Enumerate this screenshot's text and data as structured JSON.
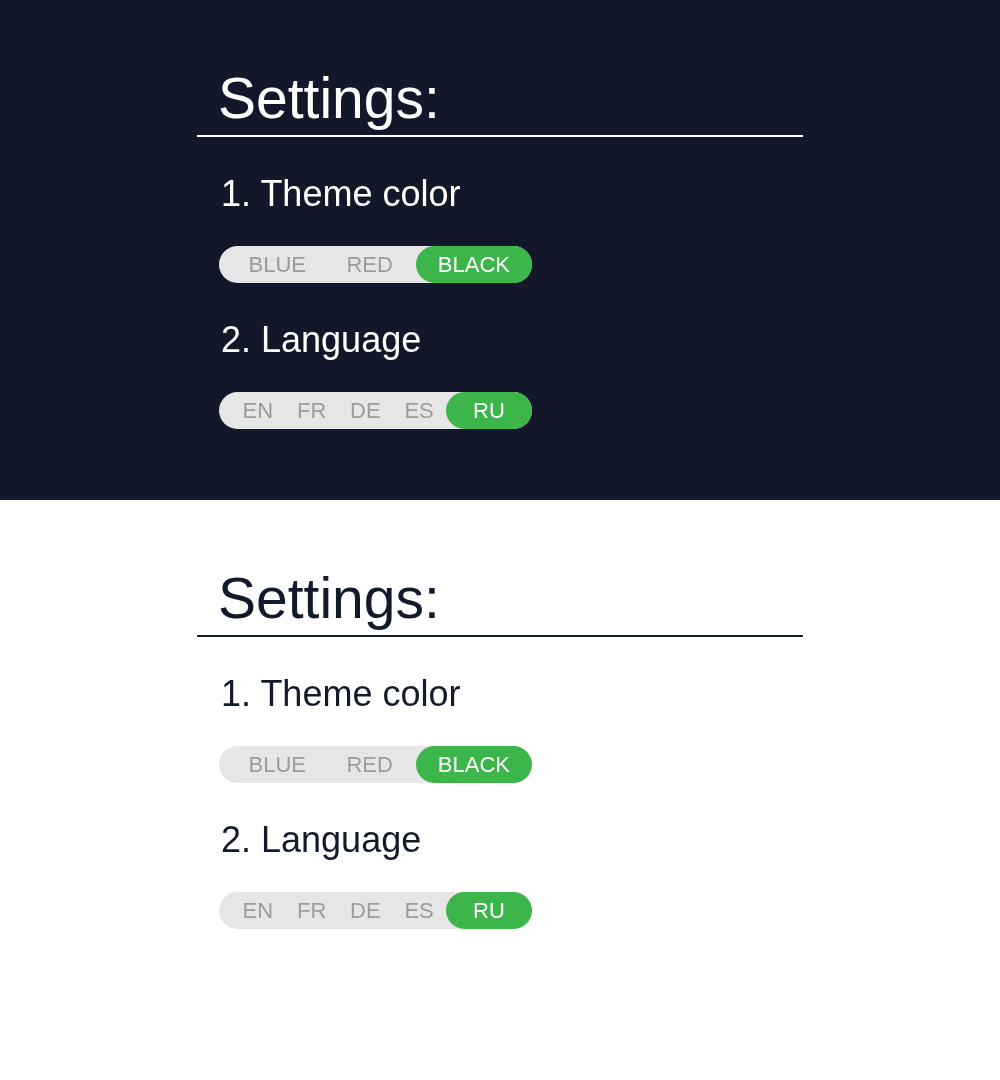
{
  "panels": [
    {
      "kind": "dark",
      "title": "Settings:",
      "sections": [
        {
          "label": "1. Theme color",
          "options": [
            {
              "label": "BLUE",
              "selected": false
            },
            {
              "label": "RED",
              "selected": false
            },
            {
              "label": "BLACK",
              "selected": true
            }
          ]
        },
        {
          "label": "2. Language",
          "options": [
            {
              "label": "EN",
              "selected": false
            },
            {
              "label": "FR",
              "selected": false
            },
            {
              "label": "DE",
              "selected": false
            },
            {
              "label": "ES",
              "selected": false
            },
            {
              "label": "RU",
              "selected": true
            }
          ]
        }
      ]
    },
    {
      "kind": "light",
      "title": "Settings:",
      "sections": [
        {
          "label": "1. Theme color",
          "options": [
            {
              "label": "BLUE",
              "selected": false
            },
            {
              "label": "RED",
              "selected": false
            },
            {
              "label": "BLACK",
              "selected": true
            }
          ]
        },
        {
          "label": "2. Language",
          "options": [
            {
              "label": "EN",
              "selected": false
            },
            {
              "label": "FR",
              "selected": false
            },
            {
              "label": "DE",
              "selected": false
            },
            {
              "label": "ES",
              "selected": false
            },
            {
              "label": "RU",
              "selected": true
            }
          ]
        }
      ]
    }
  ]
}
